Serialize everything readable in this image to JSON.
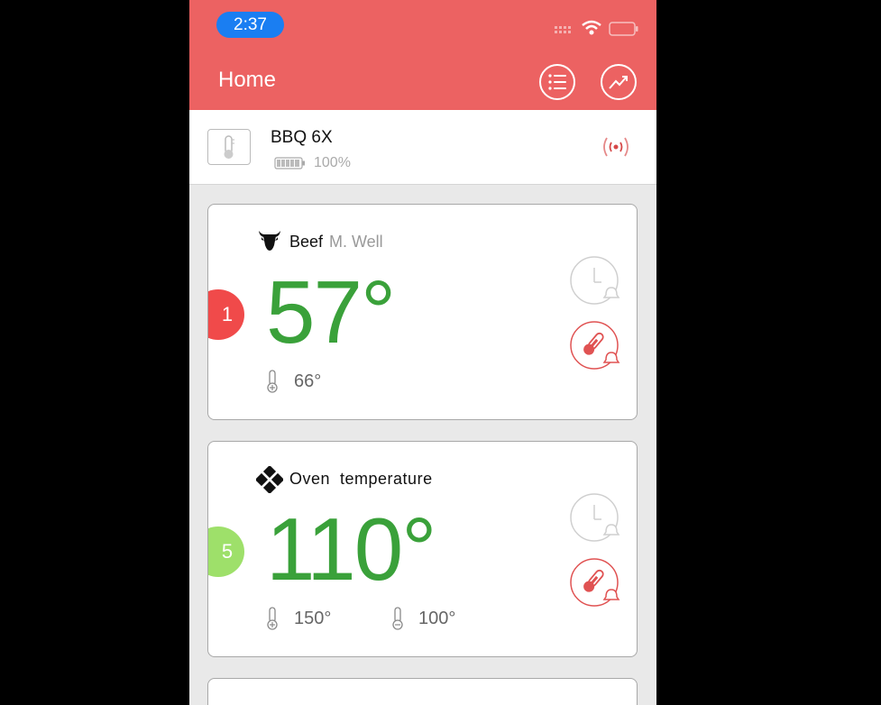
{
  "status_bar": {
    "time": "2:37"
  },
  "header": {
    "title": "Home",
    "list_button": "list-icon",
    "trend_button": "trend-icon"
  },
  "device": {
    "name": "BBQ 6X",
    "battery": "100%",
    "battery_level": 1.0
  },
  "probes": [
    {
      "number": "1",
      "badge_color": "#f04a4a",
      "meat": "Beef",
      "doneness": "M. Well",
      "temperature": "57°",
      "target": "66°"
    },
    {
      "number": "5",
      "badge_color": "#9ee06a",
      "name": "Oven  temperature",
      "temperature": "110°",
      "high": "150°",
      "low": "100°"
    }
  ],
  "colors": {
    "header": "#ec6262",
    "temperature": "#3aa13a",
    "alarm": "#e05252"
  }
}
